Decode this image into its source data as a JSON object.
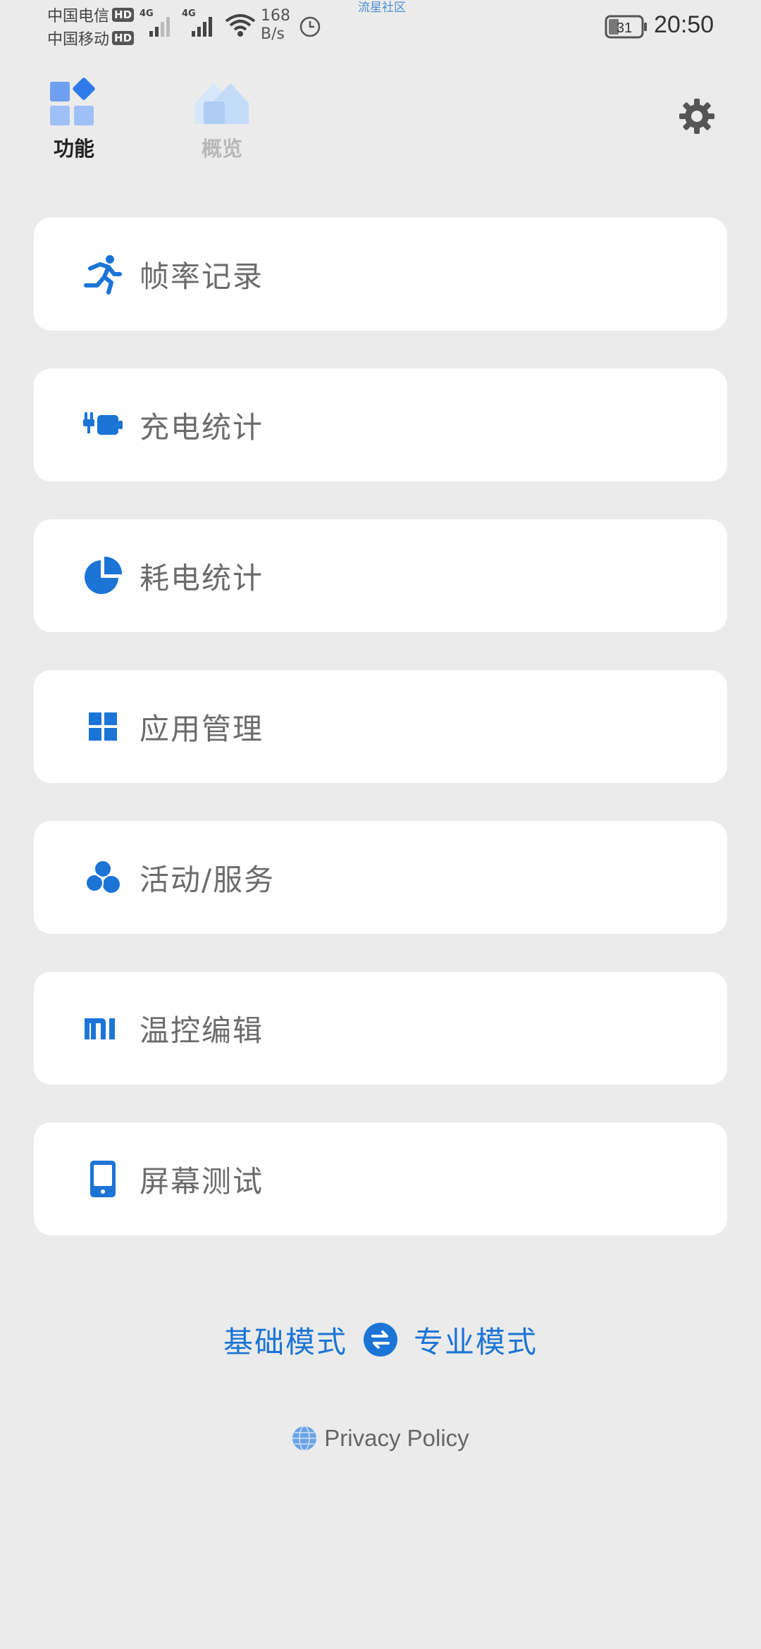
{
  "status_bar": {
    "carrier1": "中国电信",
    "carrier2": "中国移动",
    "hd_badge": "HD",
    "network1": "4G",
    "network2": "4G",
    "speed_value": "168",
    "speed_unit": "B/s",
    "community_label": "流星社区",
    "battery_level": "31",
    "time": "20:50"
  },
  "nav": {
    "tabs": [
      {
        "label": "功能",
        "active": true
      },
      {
        "label": "概览",
        "active": false
      }
    ],
    "settings_icon": "gear-icon"
  },
  "menu": {
    "items": [
      {
        "label": "帧率记录",
        "icon": "running-person-icon"
      },
      {
        "label": "充电统计",
        "icon": "charging-plug-icon"
      },
      {
        "label": "耗电统计",
        "icon": "pie-chart-icon"
      },
      {
        "label": "应用管理",
        "icon": "app-grid-icon"
      },
      {
        "label": "活动/服务",
        "icon": "three-circles-icon"
      },
      {
        "label": "温控编辑",
        "icon": "mi-logo-icon"
      },
      {
        "label": "屏幕测试",
        "icon": "phone-screen-icon"
      }
    ]
  },
  "mode_switch": {
    "basic_mode": "基础模式",
    "pro_mode": "专业模式",
    "swap_icon": "swap-arrows-icon"
  },
  "footer": {
    "privacy_label": "Privacy Policy",
    "privacy_icon": "globe-icon"
  },
  "colors": {
    "accent": "#1b74d6",
    "background": "#ebebeb",
    "card": "#ffffff",
    "label_text": "#6b6b6b"
  }
}
